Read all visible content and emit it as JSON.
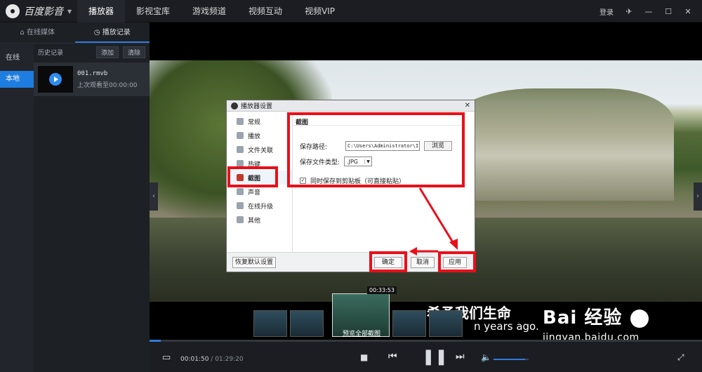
{
  "app": {
    "name": "百度影音"
  },
  "topbar": {
    "tabs": [
      "播放器",
      "影视宝库",
      "游戏频道",
      "视频互动",
      "视频VIP"
    ],
    "active_tab": 0,
    "login": "登录"
  },
  "left_panel": {
    "tabs": [
      "在线媒体",
      "播放记录"
    ],
    "side": [
      "在线",
      "本地"
    ],
    "history_title": "历史记录",
    "add": "添加",
    "clear": "清除",
    "item": {
      "filename": "001.rmvb",
      "last": "上次观看至00:00:00"
    }
  },
  "video": {
    "subtitle_cn": "希予我们生命",
    "subtitle_en": "n years ago.",
    "thumb_time": "00:33:53",
    "thumb_link": "预览全部截图"
  },
  "watermark": {
    "brand": "Bai 经验",
    "url": "jingyan.baidu.com"
  },
  "dialog": {
    "title": "播放器设置",
    "nav": [
      "常规",
      "播放",
      "文件关联",
      "热键",
      "截图",
      "声音",
      "在线升级",
      "其他"
    ],
    "active_nav": 4,
    "section": "截图",
    "path_label": "保存路径:",
    "path_value": "C:\\Users\\Administrator\\I",
    "browse": "浏览",
    "type_label": "保存文件类型:",
    "type_value": ".JPG",
    "clipboard_label": "同时保存到剪贴板（可直接粘贴）",
    "clipboard_checked": true,
    "restore": "恢复默认设置",
    "ok": "确定",
    "cancel": "取消",
    "apply": "应用"
  },
  "controls": {
    "current_time": "00:01:50",
    "total_time": "/ 01:29:20",
    "progress_fraction": 0.02,
    "volume_fraction": 0.9
  },
  "colors": {
    "accent": "#2f7bd8",
    "highlight_red": "#e8101a"
  }
}
